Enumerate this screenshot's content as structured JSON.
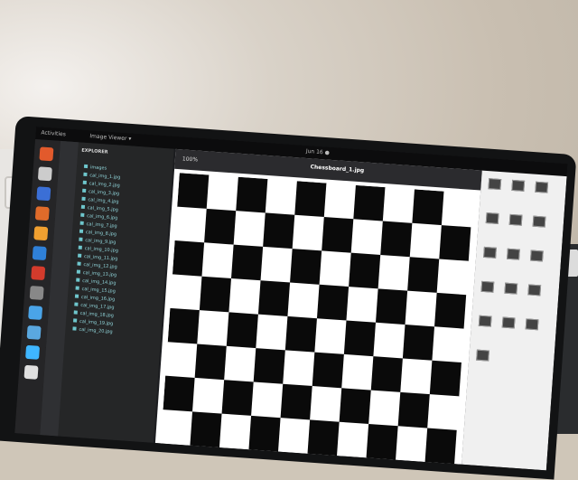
{
  "topbar": {
    "activities": "Activities",
    "app_menu": "Image Viewer ▾",
    "clock": "Jun 16  ●"
  },
  "viewer": {
    "zoom": "100%",
    "filename": "Chessboard_1.jpg"
  },
  "explorer": {
    "heading": "EXPLORER",
    "folder": "images",
    "files": [
      "cal_img_1.jpg",
      "cal_img_2.jpg",
      "cal_img_3.jpg",
      "cal_img_4.jpg",
      "cal_img_5.jpg",
      "cal_img_6.jpg",
      "cal_img_7.jpg",
      "cal_img_8.jpg",
      "cal_img_9.jpg",
      "cal_img_10.jpg",
      "cal_img_11.jpg",
      "cal_img_12.jpg",
      "cal_img_13.jpg",
      "cal_img_14.jpg",
      "cal_img_15.jpg",
      "cal_img_16.jpg",
      "cal_img_17.jpg",
      "cal_img_18.jpg",
      "cal_img_19.jpg",
      "cal_img_20.jpg"
    ]
  },
  "colors": {
    "dock_icons": [
      "#e25a2c",
      "#cccccc",
      "#3b6fd6",
      "#e06b2a",
      "#f0a030",
      "#2f80d8",
      "#d33b2c",
      "#888888",
      "#4aa4e8",
      "#5aa8e0",
      "#3fb6ff",
      "#e0e0e0"
    ]
  }
}
